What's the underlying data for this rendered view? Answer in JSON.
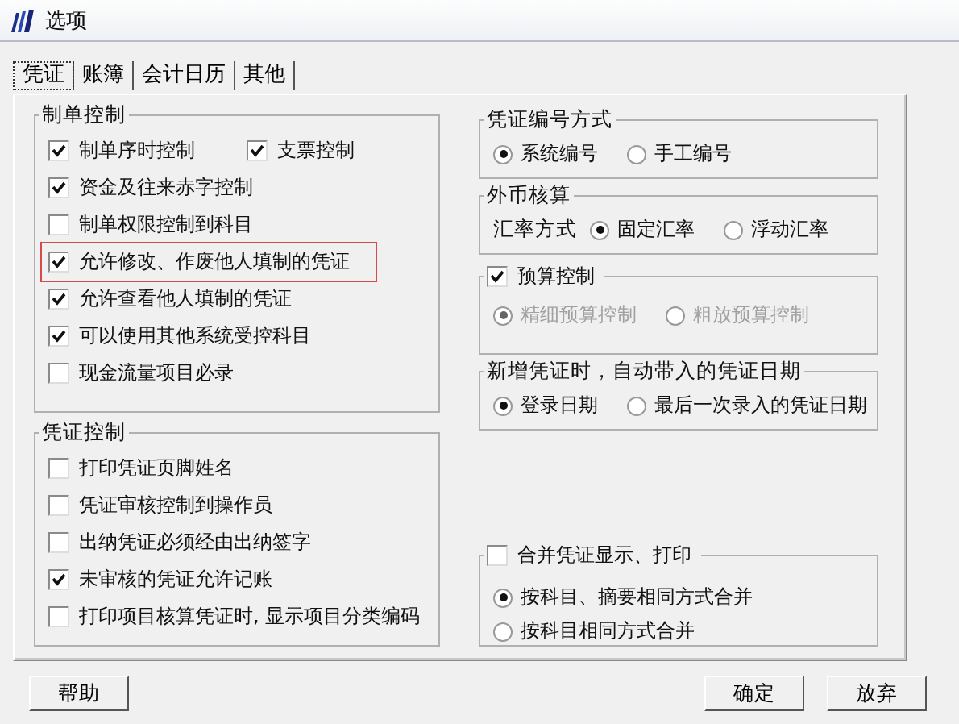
{
  "window": {
    "title": "选项"
  },
  "tabs": [
    {
      "label": "凭证",
      "selected": true
    },
    {
      "label": "账簿",
      "selected": false
    },
    {
      "label": "会计日历",
      "selected": false
    },
    {
      "label": "其他",
      "selected": false
    }
  ],
  "left_groups": [
    {
      "title": "制单控制",
      "rows": [
        [
          {
            "label": "制单序时控制",
            "checked": true,
            "highlighted": false
          },
          {
            "label": "支票控制",
            "checked": true,
            "highlighted": false
          }
        ],
        [
          {
            "label": "资金及往来赤字控制",
            "checked": true,
            "highlighted": false
          }
        ],
        [
          {
            "label": "制单权限控制到科目",
            "checked": false,
            "highlighted": false
          }
        ],
        [
          {
            "label": "允许修改、作废他人填制的凭证",
            "checked": true,
            "highlighted": true
          }
        ],
        [
          {
            "label": "允许查看他人填制的凭证",
            "checked": true,
            "highlighted": false
          }
        ],
        [
          {
            "label": "可以使用其他系统受控科目",
            "checked": true,
            "highlighted": false
          }
        ],
        [
          {
            "label": "现金流量项目必录",
            "checked": false,
            "highlighted": false
          }
        ]
      ]
    },
    {
      "title": "凭证控制",
      "rows": [
        [
          {
            "label": "打印凭证页脚姓名",
            "checked": false,
            "highlighted": false
          }
        ],
        [
          {
            "label": "凭证审核控制到操作员",
            "checked": false,
            "highlighted": false
          }
        ],
        [
          {
            "label": "出纳凭证必须经由出纳签字",
            "checked": false,
            "highlighted": false
          }
        ],
        [
          {
            "label": "未审核的凭证允许记账",
            "checked": true,
            "highlighted": false
          }
        ],
        [
          {
            "label": "打印项目核算凭证时, 显示项目分类编码",
            "checked": false,
            "highlighted": false
          }
        ]
      ]
    }
  ],
  "right_groups": [
    {
      "kind": "radio_row",
      "title": "凭证编号方式",
      "options": [
        {
          "label": "系统编号",
          "selected": true,
          "disabled": false
        },
        {
          "label": "手工编号",
          "selected": false,
          "disabled": false
        }
      ]
    },
    {
      "kind": "radio_row",
      "title": "外币核算",
      "label": "汇率方式",
      "options": [
        {
          "label": "固定汇率",
          "selected": true,
          "disabled": false
        },
        {
          "label": "浮动汇率",
          "selected": false,
          "disabled": false
        }
      ]
    },
    {
      "kind": "check_title_row",
      "title": "预算控制",
      "checked": true,
      "options": [
        {
          "label": "精细预算控制",
          "selected": true,
          "disabled": true
        },
        {
          "label": "粗放预算控制",
          "selected": false,
          "disabled": true
        }
      ]
    },
    {
      "kind": "radio_row",
      "title": "新增凭证时，自动带入的凭证日期",
      "options": [
        {
          "label": "登录日期",
          "selected": true,
          "disabled": false
        },
        {
          "label": "最后一次录入的凭证日期",
          "selected": false,
          "disabled": false
        }
      ]
    },
    {
      "kind": "check_title_column",
      "title": "合并凭证显示、打印",
      "checked": false,
      "options": [
        {
          "label": "按科目、摘要相同方式合并",
          "selected": true,
          "disabled": false
        },
        {
          "label": "按科目相同方式合并",
          "selected": false,
          "disabled": false
        }
      ]
    }
  ],
  "buttons": {
    "help": "帮助",
    "ok": "确定",
    "cancel": "放弃"
  }
}
